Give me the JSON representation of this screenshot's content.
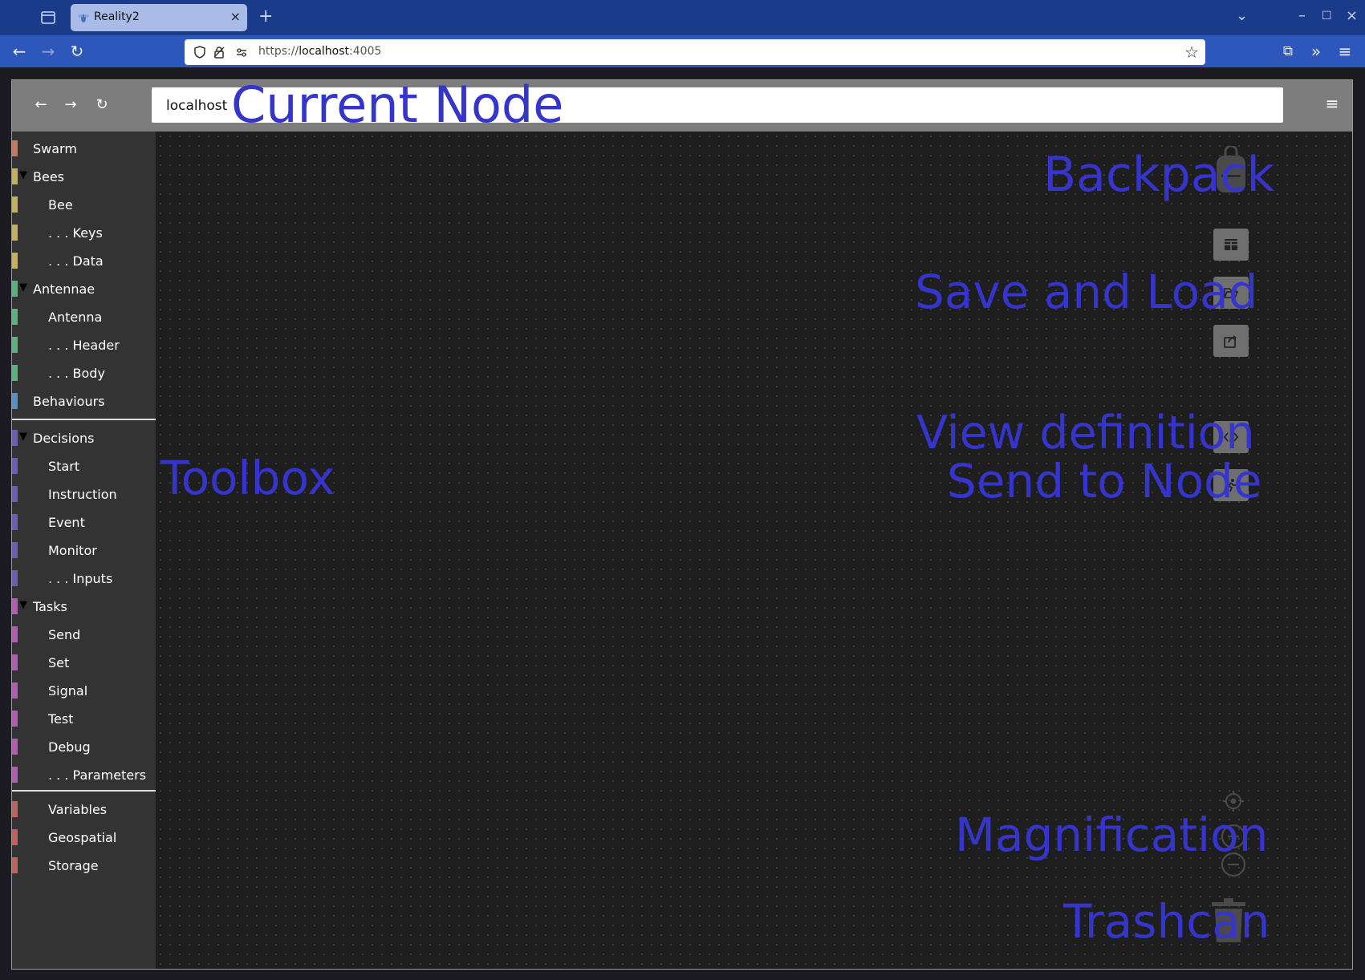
{
  "browser": {
    "tab_title": "Reality2",
    "url_scheme": "https://",
    "url_host": "localhost",
    "url_port": ":4005"
  },
  "app": {
    "node_value": "localhost"
  },
  "toolbox": {
    "items": [
      {
        "label": "Swarm",
        "color": "#c07a60"
      },
      {
        "label": "Bees",
        "color": "#c0b060"
      },
      {
        "label": "Bee",
        "color": "#c0b060"
      },
      {
        "label": ". . . Keys",
        "color": "#c0b060"
      },
      {
        "label": ". . . Data",
        "color": "#c0b060"
      },
      {
        "label": "Antennae",
        "color": "#5fb080"
      },
      {
        "label": "Antenna",
        "color": "#5fb080"
      },
      {
        "label": ". . . Header",
        "color": "#5fb080"
      },
      {
        "label": ". . . Body",
        "color": "#5fb080"
      },
      {
        "label": "Behaviours",
        "color": "#5a8fc0"
      },
      {
        "label": "Decisions",
        "color": "#6a5fb0"
      },
      {
        "label": "Start",
        "color": "#6a5fb0"
      },
      {
        "label": "Instruction",
        "color": "#6a5fb0"
      },
      {
        "label": "Event",
        "color": "#6a5fb0"
      },
      {
        "label": "Monitor",
        "color": "#6a5fb0"
      },
      {
        "label": ". . . Inputs",
        "color": "#6a5fb0"
      },
      {
        "label": "Tasks",
        "color": "#b05fb0"
      },
      {
        "label": "Send",
        "color": "#b05fb0"
      },
      {
        "label": "Set",
        "color": "#b05fb0"
      },
      {
        "label": "Signal",
        "color": "#b05fb0"
      },
      {
        "label": "Test",
        "color": "#b05fb0"
      },
      {
        "label": "Debug",
        "color": "#b05fb0"
      },
      {
        "label": ". . . Parameters",
        "color": "#b05fb0"
      },
      {
        "label": "Variables",
        "color": "#c06060"
      },
      {
        "label": "Geospatial",
        "color": "#c06060"
      },
      {
        "label": "Storage",
        "color": "#c06060"
      }
    ]
  },
  "annotations": {
    "current_node": "Current Node",
    "backpack": "Backpack",
    "save_and_load": "Save and Load",
    "view_definition": "View definition",
    "send_to_node": "Send to Node",
    "toolbox": "Toolbox",
    "magnification": "Magnification",
    "trashcan": "Trashcan"
  }
}
